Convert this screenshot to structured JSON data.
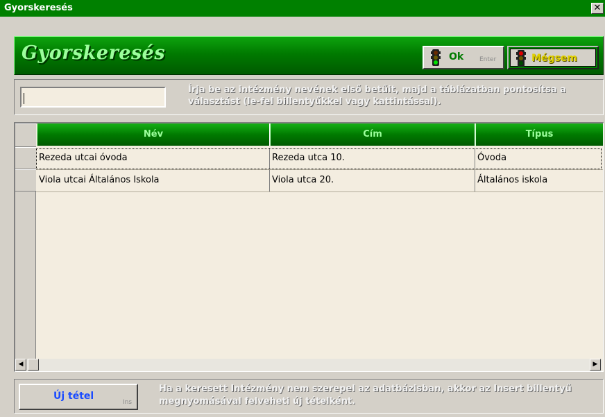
{
  "window": {
    "title": "Gyorskeresés"
  },
  "header": {
    "title": "Gyorskeresés",
    "ok_label": "Ok",
    "ok_hint": "Enter",
    "cancel_label": "Mégsem"
  },
  "search": {
    "value": "",
    "hint": "Írja be az intézmény nevének első betűit, majd a táblázatban pontosítsa a választást (le-fel billentyűkkel vagy kattintással)."
  },
  "table": {
    "columns": [
      "Név",
      "Cím",
      "Típus"
    ],
    "rows": [
      [
        "Rezeda utcai óvoda",
        "Rezeda utca  10.",
        "Óvoda"
      ],
      [
        "Viola utcai Általános Iskola",
        "Viola utca  20.",
        "Általános iskola"
      ]
    ],
    "selected_row": 0
  },
  "footer": {
    "new_label": "Új tétel",
    "new_hint": "Ins",
    "hint": "Ha a keresett Intézmény nem szerepel az adatbázisban, akkor az Insert billentyű megnyomásával felveheti új tételként."
  },
  "colors": {
    "titlebar": "#008000",
    "header_green": "#007a00",
    "header_text": "#9cff9c",
    "new_button_text": "#1a4bff",
    "cancel_text": "#e0d000",
    "grid_bg": "#f3ede0"
  }
}
